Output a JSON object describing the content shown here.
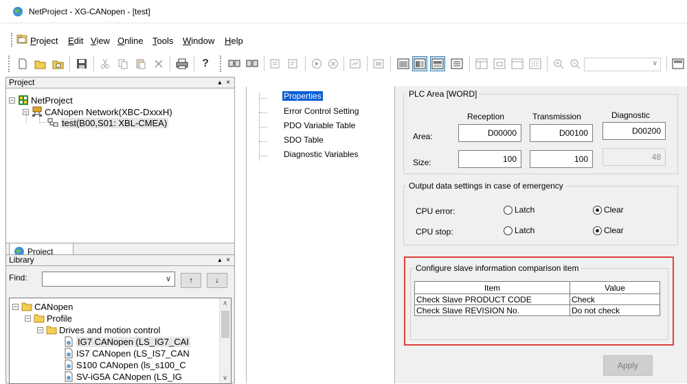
{
  "window": {
    "title": "NetProject - XG-CANopen - [test]"
  },
  "menu": {
    "items": [
      {
        "label": "Project",
        "mnemonic": "P",
        "rest": "roject"
      },
      {
        "label": "Edit",
        "mnemonic": "E",
        "rest": "dit"
      },
      {
        "label": "View",
        "mnemonic": "V",
        "rest": "iew"
      },
      {
        "label": "Online",
        "mnemonic": "O",
        "rest": "nline"
      },
      {
        "label": "Tools",
        "mnemonic": "T",
        "rest": "ools"
      },
      {
        "label": "Window",
        "mnemonic": "W",
        "rest": "indow"
      },
      {
        "label": "Help",
        "mnemonic": "H",
        "rest": "elp"
      }
    ]
  },
  "project_panel": {
    "title": "Project",
    "controls": "▴ ×",
    "tree": {
      "root": "NetProject",
      "network": "CANopen Network(XBC-DxxxH)",
      "device": "test(B00,S01: XBL-CMEA)"
    },
    "tab_label": "Project"
  },
  "library_panel": {
    "title": "Library",
    "controls": "▴ ×",
    "find_label": "Find:",
    "find_value": "",
    "up_button": "↑",
    "down_button": "↓",
    "tree": {
      "root": "CANopen",
      "profile": "Profile",
      "category": "Drives and motion control",
      "items": [
        "IG7 CANopen (LS_IG7_CAI",
        "IS7 CANopen (LS_IS7_CAN",
        "S100 CANopen (ls_s100_C",
        "SV-iG5A CANopen (LS_IG"
      ]
    }
  },
  "nav": {
    "items": [
      "Properties",
      "Error Control Setting",
      "PDO Variable Table",
      "SDO Table",
      "Diagnostic Variables"
    ],
    "active_index": 0
  },
  "plc_area": {
    "title": "PLC Area [WORD]",
    "headers": {
      "reception": "Reception",
      "transmission": "Transmission",
      "diagnostic": "Diagnostic"
    },
    "area_label": "Area:",
    "size_label": "Size:",
    "area": {
      "reception": "D00000",
      "transmission": "D00100",
      "diagnostic": "D00200"
    },
    "size": {
      "reception": "100",
      "transmission": "100",
      "diagnostic": "48"
    }
  },
  "emergency": {
    "title": "Output data settings in case of emergency",
    "rows": [
      {
        "label": "CPU error:",
        "latch": "Latch",
        "clear": "Clear",
        "selected": "clear"
      },
      {
        "label": "CPU stop:",
        "latch": "Latch",
        "clear": "Clear",
        "selected": "clear"
      }
    ]
  },
  "comparison": {
    "title": "Configure slave information comparison item",
    "columns": [
      "Item",
      "Value"
    ],
    "rows": [
      {
        "item": "Check Slave PRODUCT CODE",
        "value": "Check"
      },
      {
        "item": "Check Slave REVISION No.",
        "value": "Do not check"
      }
    ]
  },
  "apply_label": "Apply",
  "colors": {
    "highlight_border": "#e03c3c",
    "selection": "#0a5fd3",
    "panel_bg": "#f0f0f0"
  }
}
